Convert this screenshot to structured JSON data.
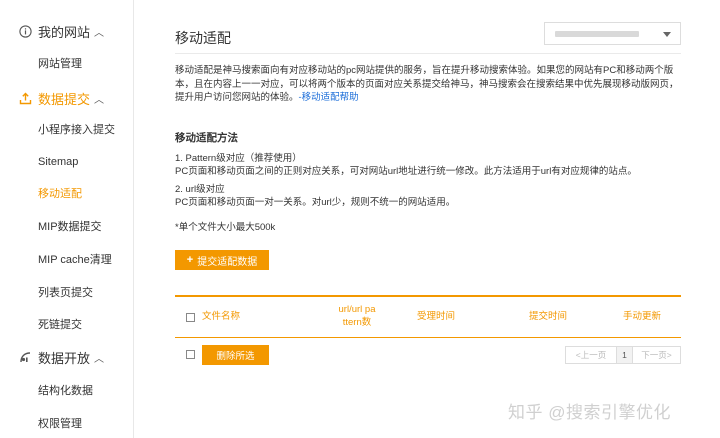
{
  "sidebar": {
    "sections": [
      {
        "label": "我的网站",
        "icon": "info-circle-icon",
        "items": [
          "网站管理"
        ]
      },
      {
        "label": "数据提交",
        "icon": "upload-icon",
        "items": [
          "小程序接入提交",
          "Sitemap",
          "移动适配",
          "MIP数据提交",
          "MIP cache清理",
          "列表页提交",
          "死链提交"
        ]
      },
      {
        "label": "数据开放",
        "icon": "chart-icon",
        "items": [
          "结构化数据",
          "权限管理"
        ]
      }
    ],
    "active_item": "移动适配"
  },
  "main": {
    "title": "移动适配",
    "site_select_value": "",
    "description_text": "移动适配是神马搜索面向有对应移动站的pc网站提供的服务，旨在提升移动搜索体验。如果您的网站有PC和移动两个版本，且在内容上一一对应，可以将两个版本的页面对应关系提交给神马，神马搜索会在搜索结果中优先展现移动版网页，提升用户访问您网站的体验。",
    "help_link": "-移动适配帮助",
    "method_title": "移动适配方法",
    "method1_title": "1. Pattern级对应（推荐使用）",
    "method1_desc": "PC页面和移动页面之间的正则对应关系，可对网站url地址进行统一修改。此方法适用于url有对应规律的站点。",
    "method2_title": "2. url级对应",
    "method2_desc": "PC页面和移动页面一对一关系。对url少，规则不统一的网站适用。",
    "size_note": "*单个文件大小最大500k",
    "submit_button": "提交适配数据",
    "table_headers": [
      "文件名称",
      "url/url pa",
      "ttern数",
      "受理时间",
      "提交时间",
      "手动更新"
    ],
    "delete_button": "删除所选",
    "pager": {
      "prev": "<上一页",
      "current": "1",
      "next": "下一页>"
    }
  },
  "watermark": "知乎 @搜索引擎优化",
  "colors": {
    "accent": "#f39800",
    "link": "#1e6fd9"
  }
}
